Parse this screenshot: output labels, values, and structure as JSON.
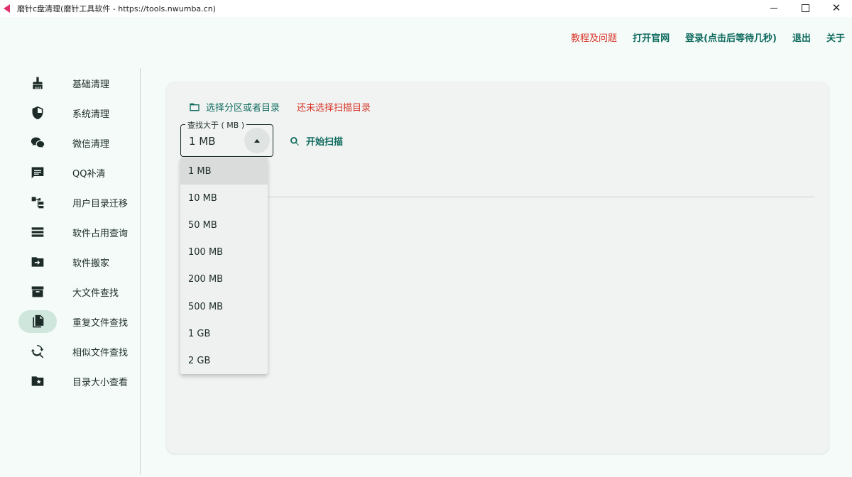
{
  "window": {
    "title": "磨针c盘清理(磨针工具软件 - https://tools.nwumba.cn)",
    "minimize": "",
    "maximize": "",
    "close": "✕"
  },
  "topnav": {
    "tutorial": "教程及问题",
    "official_site": "打开官网",
    "login": "登录(点击后等待几秒)",
    "logout": "退出",
    "about": "关于"
  },
  "sidebar": {
    "items": [
      {
        "label": "基础清理",
        "icon": "broom-icon"
      },
      {
        "label": "系统清理",
        "icon": "shield-icon"
      },
      {
        "label": "微信清理",
        "icon": "wechat-icon"
      },
      {
        "label": "QQ补清",
        "icon": "chat-icon"
      },
      {
        "label": "用户目录迁移",
        "icon": "tree-icon"
      },
      {
        "label": "软件占用查询",
        "icon": "list-icon"
      },
      {
        "label": "软件搬家",
        "icon": "folder-move-icon"
      },
      {
        "label": "大文件查找",
        "icon": "archive-icon"
      },
      {
        "label": "重复文件查找",
        "icon": "copy-icon"
      },
      {
        "label": "相似文件查找",
        "icon": "search-refresh-icon"
      },
      {
        "label": "目录大小查看",
        "icon": "folder-star-icon"
      }
    ],
    "active_index": 8
  },
  "main": {
    "choose_dir_label": "选择分区或者目录",
    "dir_status": "还未选择扫描目录",
    "size_select": {
      "legend": "查找大于 ( MB )",
      "value": "1 MB"
    },
    "scan_label": "开始扫描"
  },
  "dropdown": {
    "options": [
      "1 MB",
      "10 MB",
      "50 MB",
      "100 MB",
      "200 MB",
      "500 MB",
      "1 GB",
      "2 GB"
    ],
    "selected_index": 0
  },
  "colors": {
    "accent": "#0f6b5f",
    "warning": "#d8342a",
    "background": "#f5fbf8",
    "card": "#f0f3f1"
  }
}
